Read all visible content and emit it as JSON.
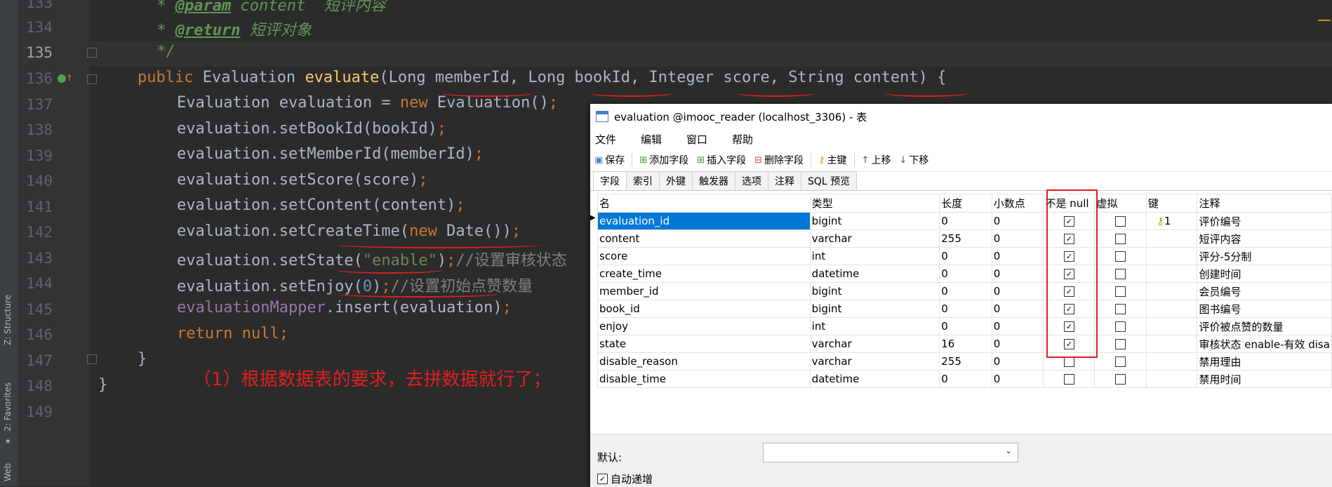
{
  "ide": {
    "side_tabs": {
      "web": "Web",
      "favorites": "2: Favorites",
      "structure": "Z: Structure"
    },
    "line_numbers": [
      "133",
      "134",
      "135",
      "136",
      "137",
      "138",
      "139",
      "140",
      "141",
      "142",
      "143",
      "144",
      "145",
      "146",
      "147",
      "148",
      "149"
    ],
    "code": {
      "l133_star": " * ",
      "l133_tag": "@param",
      "l133_rest": " content  短评内容",
      "l134_star": " * ",
      "l134_tag": "@return",
      "l134_rest": " 短评对象",
      "l135": " */",
      "public": "public",
      "class_name": " Evaluation ",
      "method": "evaluate",
      "params": "(Long memberId, Long bookId, Integer score, String content) {",
      "l137_a": "Evaluation evaluation = ",
      "l137_new": "new",
      "l137_b": " Evaluation()",
      "l138": "evaluation.setBookId(bookId)",
      "l139": "evaluation.setMemberId(memberId)",
      "l140": "evaluation.setScore(score)",
      "l141": "evaluation.setContent(content)",
      "l142_a": "evaluation.setCreateTime(",
      "l142_new": "new",
      "l142_b": " Date())",
      "l143_a": "evaluation.setState(",
      "l143_str": "\"enable\"",
      "l143_b": ")",
      "l143_cm": "//设置审核状态",
      "l144_a": "evaluation.setEnjoy(",
      "l144_num": "0",
      "l144_b": ")",
      "l144_cm": "//设置初始点赞数量",
      "l145_field": "evaluationMapper",
      "l145_rest": ".insert(evaluation)",
      "l146_kw": "return null",
      "semicolon": ";",
      "brace_close": "}"
    },
    "annotation": "（1）根据数据表的要求，去拼数据就行了；"
  },
  "navicat": {
    "title": "evaluation @imooc_reader (localhost_3306) - 表",
    "menu": [
      "文件",
      "编辑",
      "窗口",
      "帮助"
    ],
    "toolbar": {
      "save": "保存",
      "add_field": "添加字段",
      "insert_field": "插入字段",
      "delete_field": "删除字段",
      "primary_key": "主键",
      "move_up": "上移",
      "move_down": "下移"
    },
    "tabs": [
      "字段",
      "索引",
      "外键",
      "触发器",
      "选项",
      "注释",
      "SQL 预览"
    ],
    "columns": [
      "名",
      "类型",
      "长度",
      "小数点",
      "不是 null",
      "虚拟",
      "键",
      "注释"
    ],
    "rows": [
      {
        "name": "evaluation_id",
        "type": "bigint",
        "length": "0",
        "decimal": "0",
        "not_null": true,
        "virtual": false,
        "key": "1",
        "comment": "评价编号"
      },
      {
        "name": "content",
        "type": "varchar",
        "length": "255",
        "decimal": "0",
        "not_null": true,
        "virtual": false,
        "key": "",
        "comment": "短评内容"
      },
      {
        "name": "score",
        "type": "int",
        "length": "0",
        "decimal": "0",
        "not_null": true,
        "virtual": false,
        "key": "",
        "comment": "评分-5分制"
      },
      {
        "name": "create_time",
        "type": "datetime",
        "length": "0",
        "decimal": "0",
        "not_null": true,
        "virtual": false,
        "key": "",
        "comment": "创建时间"
      },
      {
        "name": "member_id",
        "type": "bigint",
        "length": "0",
        "decimal": "0",
        "not_null": true,
        "virtual": false,
        "key": "",
        "comment": "会员编号"
      },
      {
        "name": "book_id",
        "type": "bigint",
        "length": "0",
        "decimal": "0",
        "not_null": true,
        "virtual": false,
        "key": "",
        "comment": "图书编号"
      },
      {
        "name": "enjoy",
        "type": "int",
        "length": "0",
        "decimal": "0",
        "not_null": true,
        "virtual": false,
        "key": "",
        "comment": "评价被点赞的数量"
      },
      {
        "name": "state",
        "type": "varchar",
        "length": "16",
        "decimal": "0",
        "not_null": true,
        "virtual": false,
        "key": "",
        "comment": "审核状态 enable-有效 disa"
      },
      {
        "name": "disable_reason",
        "type": "varchar",
        "length": "255",
        "decimal": "0",
        "not_null": false,
        "virtual": false,
        "key": "",
        "comment": "禁用理由"
      },
      {
        "name": "disable_time",
        "type": "datetime",
        "length": "0",
        "decimal": "0",
        "not_null": false,
        "virtual": false,
        "key": "",
        "comment": "禁用时间"
      }
    ],
    "default_label": "默认:",
    "auto_increment_label": "自动递增",
    "auto_increment_checked": true
  }
}
